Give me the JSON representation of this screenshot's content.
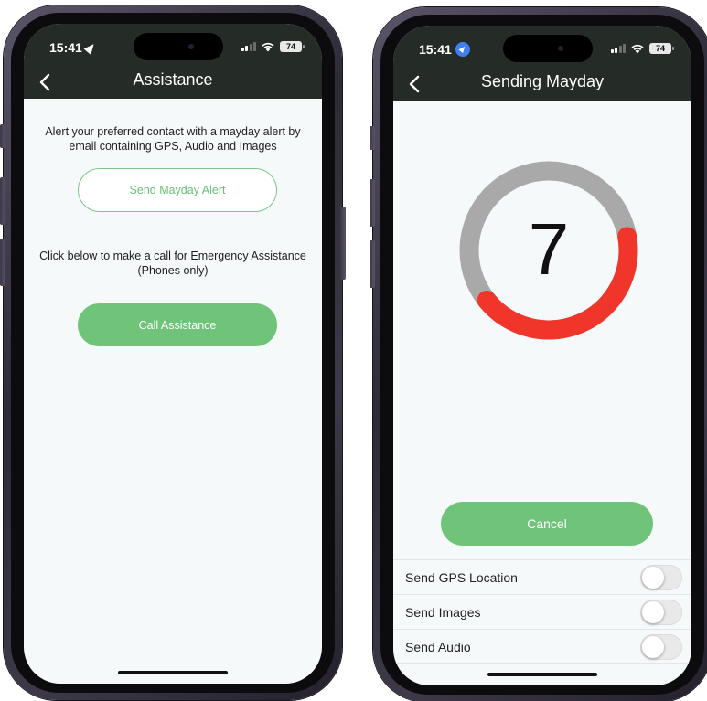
{
  "left_screen": {
    "status_bar": {
      "time": "15:41",
      "battery": "74"
    },
    "header": {
      "title": "Assistance"
    },
    "mayday_description": "Alert your preferred contact with a mayday alert by email containing GPS, Audio and Images",
    "send_mayday_label": "Send Mayday Alert",
    "call_description": "Click below to make a call for Emergency Assistance (Phones only)",
    "call_assistance_label": "Call Assistance"
  },
  "right_screen": {
    "status_bar": {
      "time": "15:41",
      "battery": "74"
    },
    "header": {
      "title": "Sending Mayday"
    },
    "countdown": {
      "value": "7",
      "progress_fraction": 0.42
    },
    "cancel_label": "Cancel",
    "options": [
      {
        "label": "Send GPS Location",
        "enabled": false
      },
      {
        "label": "Send Images",
        "enabled": false
      },
      {
        "label": "Send Audio",
        "enabled": false
      }
    ]
  },
  "icons": [
    "back-chevron-icon",
    "location-arrow-icon",
    "signal-icon",
    "wifi-icon",
    "battery-icon"
  ],
  "colors": {
    "header_bg": "#252c27",
    "accent_green": "#70c47a",
    "ring_track": "#a9a9a9",
    "ring_progress": "#f0352a",
    "screen_bg": "#f6f9fa"
  }
}
